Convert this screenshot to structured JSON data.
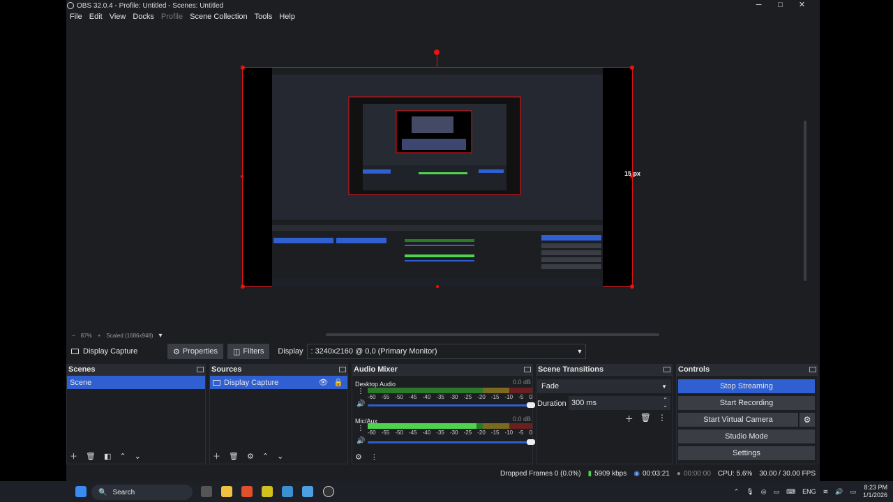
{
  "window": {
    "title": "OBS 32.0.4 - Profile: Untitled - Scenes: Untitled",
    "minimize": "─",
    "maximize": "□",
    "close": "✕"
  },
  "menu": {
    "file": "File",
    "edit": "Edit",
    "view": "View",
    "docks": "Docks",
    "profile": "Profile",
    "scene_collection": "Scene Collection",
    "tools": "Tools",
    "help": "Help"
  },
  "preview": {
    "px_label": "15 px",
    "zoom_minus": "−",
    "zoom_value": "87%",
    "zoom_plus": "+",
    "scale_mode": "Scaled (1686x948)",
    "scale_dropdown": "▾"
  },
  "source_toolbar": {
    "source_name": "Display Capture",
    "properties": "Properties",
    "filters": "Filters",
    "display_label": "Display",
    "display_value": ": 3240x2160 @ 0,0 (Primary Monitor)"
  },
  "scenes": {
    "title": "Scenes",
    "items": [
      "Scene"
    ]
  },
  "sources": {
    "title": "Sources",
    "items": [
      "Display Capture"
    ]
  },
  "audio_mixer": {
    "title": "Audio Mixer",
    "channels": [
      {
        "name": "Desktop Audio",
        "db": "0.0 dB",
        "level": 0.0
      },
      {
        "name": "Mic/Aux",
        "db": "0.0 dB",
        "level": 0.66
      }
    ],
    "ticks": [
      "-60",
      "-55",
      "-50",
      "-45",
      "-40",
      "-35",
      "-30",
      "-25",
      "-20",
      "-15",
      "-10",
      "-5",
      "0"
    ]
  },
  "scene_transitions": {
    "title": "Scene Transitions",
    "transition": "Fade",
    "duration_label": "Duration",
    "duration_value": "300 ms"
  },
  "controls": {
    "title": "Controls",
    "stop_streaming": "Stop Streaming",
    "start_recording": "Start Recording",
    "start_virtual_camera": "Start Virtual Camera",
    "studio_mode": "Studio Mode",
    "settings": "Settings"
  },
  "status": {
    "dropped_frames": "Dropped Frames 0 (0.0%)",
    "bitrate": "5909 kbps",
    "stream_time": "00:03:21",
    "record_time": "00:00:00",
    "cpu": "CPU: 5.6%",
    "fps": "30.00 / 30.00 FPS"
  },
  "taskbar": {
    "search": "Search",
    "language": "ENG",
    "time": "8:23 PM",
    "date": "1/1/2026"
  },
  "colors": {
    "accent": "#2f5fd1",
    "selection_border": "#e11111",
    "background": "#1c1e22"
  }
}
